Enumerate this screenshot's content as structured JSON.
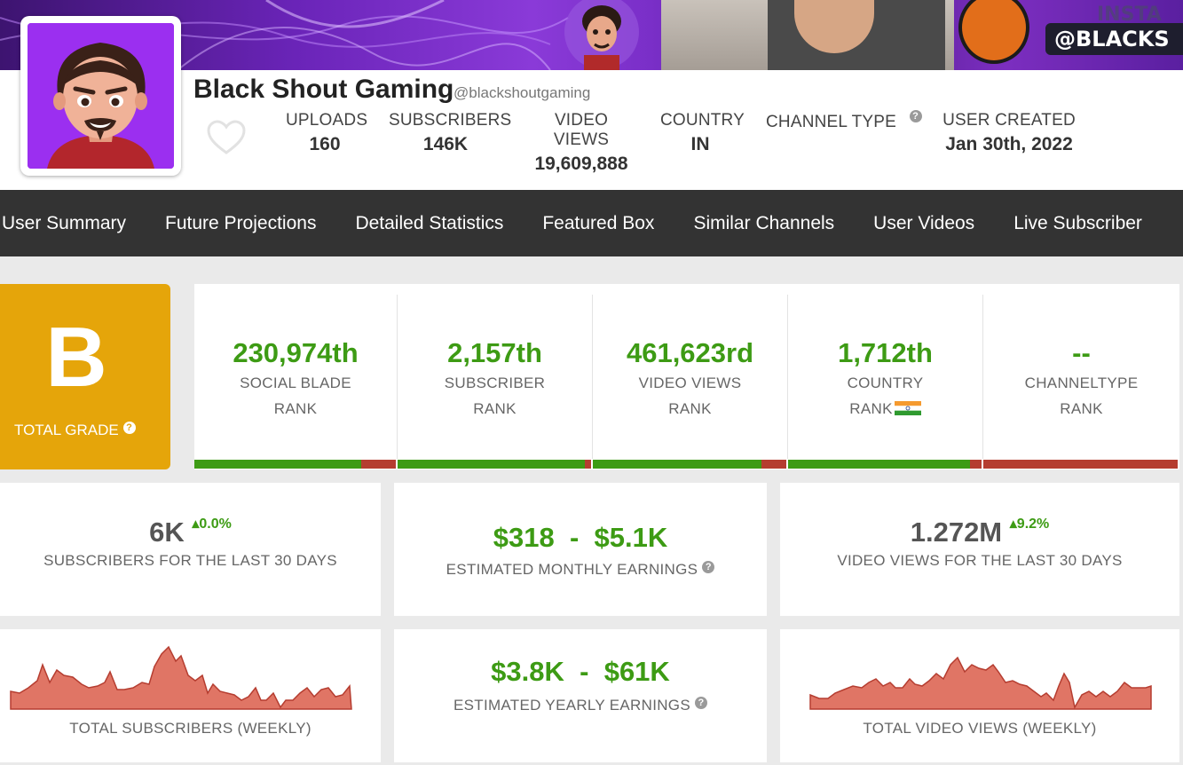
{
  "banner": {
    "handle_text": "@BLACKS",
    "insta_text": "INSTA"
  },
  "channel": {
    "name": "Black Shout Gaming",
    "handle": "@blackshoutgaming"
  },
  "stats": [
    {
      "label": "UPLOADS",
      "value": "160"
    },
    {
      "label": "SUBSCRIBERS",
      "value": "146K"
    },
    {
      "label": "VIDEO VIEWS",
      "value": "19,609,888"
    },
    {
      "label": "COUNTRY",
      "value": "IN"
    },
    {
      "label": "CHANNEL TYPE",
      "value": ""
    },
    {
      "label": "USER CREATED",
      "value": "Jan 30th, 2022"
    }
  ],
  "nav": [
    "User Summary",
    "Future Projections",
    "Detailed Statistics",
    "Featured Box",
    "Similar Channels",
    "User Videos",
    "Live Subscriber"
  ],
  "grade": {
    "letter": "B",
    "label": "TOTAL GRADE"
  },
  "ranks": [
    {
      "value": "230,974th",
      "line1": "SOCIAL BLADE",
      "line2": "RANK",
      "fraction": 0.83
    },
    {
      "value": "2,157th",
      "line1": "SUBSCRIBER",
      "line2": "RANK",
      "fraction": 0.97
    },
    {
      "value": "461,623rd",
      "line1": "VIDEO VIEWS",
      "line2": "RANK",
      "fraction": 0.87
    },
    {
      "value": "1,712th",
      "line1": "COUNTRY",
      "line2": "RANK",
      "fraction": 0.94
    },
    {
      "value": "--",
      "line1": "CHANNELTYPE",
      "line2": "RANK",
      "fraction": 0.0
    }
  ],
  "metrics": {
    "subs30": {
      "value": "6K",
      "change": "0.0%",
      "caption": "SUBSCRIBERS FOR THE LAST 30 DAYS"
    },
    "monthly": {
      "low": "$318",
      "sep": "-",
      "high": "$5.1K",
      "caption": "ESTIMATED MONTHLY EARNINGS"
    },
    "views30": {
      "value": "1.272M",
      "change": "9.2%",
      "caption": "VIDEO VIEWS FOR THE LAST 30 DAYS"
    },
    "yearly": {
      "low": "$3.8K",
      "sep": "-",
      "high": "$61K",
      "caption": "ESTIMATED YEARLY EARNINGS"
    }
  },
  "sparklines": {
    "subs_caption": "TOTAL SUBSCRIBERS (WEEKLY)",
    "views_caption": "TOTAL VIDEO VIEWS (WEEKLY)"
  },
  "colors": {
    "accent_green": "#3d9b14",
    "rank_bar_red": "#b53d30",
    "grade_orange": "#e5a50a",
    "nav_bg": "#333333",
    "sparkline_fill": "#e07565"
  }
}
